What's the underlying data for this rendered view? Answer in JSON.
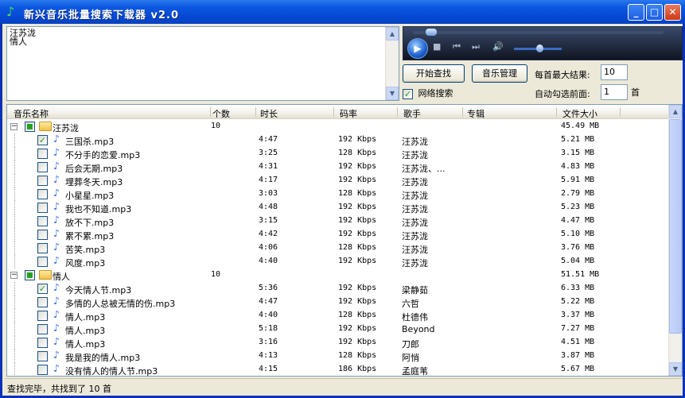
{
  "window": {
    "title": "新兴音乐批量搜索下载器 v2.0",
    "minimize": "_",
    "maximize": "□",
    "close": "✕"
  },
  "keywords": [
    "汪苏泷",
    "情人"
  ],
  "player": {
    "play": "▶",
    "stop": "■",
    "prev": "⏮",
    "next": "⏭",
    "volume": "🔊"
  },
  "controls": {
    "search_button": "开始查找",
    "manage_button": "音乐管理",
    "network_search_label": "网络搜索",
    "network_search_checked": true,
    "max_results_label": "每首最大结果:",
    "max_results_value": "10",
    "auto_select_label": "自动勾选前面:",
    "auto_select_value": "1",
    "auto_select_unit": "首"
  },
  "columns": [
    "音乐名称",
    "个数",
    "时长",
    "码率",
    "歌手",
    "专辑",
    "文件大小"
  ],
  "groups": [
    {
      "name": "汪苏泷",
      "count": "10",
      "size": "45.49 MB",
      "items": [
        {
          "name": "三国杀.mp3",
          "duration": "4:47",
          "bitrate": "192 Kbps",
          "singer": "汪苏泷",
          "size": "5.21 MB",
          "checked": true
        },
        {
          "name": "不分手的恋爱.mp3",
          "duration": "3:25",
          "bitrate": "128 Kbps",
          "singer": "汪苏泷",
          "size": "3.15 MB",
          "checked": false
        },
        {
          "name": "后会无期.mp3",
          "duration": "4:31",
          "bitrate": "192 Kbps",
          "singer": "汪苏泷、...",
          "size": "4.83 MB",
          "checked": false
        },
        {
          "name": "埋葬冬天.mp3",
          "duration": "4:17",
          "bitrate": "192 Kbps",
          "singer": "汪苏泷",
          "size": "5.91 MB",
          "checked": false
        },
        {
          "name": "小星星.mp3",
          "duration": "3:03",
          "bitrate": "128 Kbps",
          "singer": "汪苏泷",
          "size": "2.79 MB",
          "checked": false
        },
        {
          "name": "我也不知道.mp3",
          "duration": "4:48",
          "bitrate": "192 Kbps",
          "singer": "汪苏泷",
          "size": "5.23 MB",
          "checked": false
        },
        {
          "name": "放不下.mp3",
          "duration": "3:15",
          "bitrate": "192 Kbps",
          "singer": "汪苏泷",
          "size": "4.47 MB",
          "checked": false
        },
        {
          "name": "累不累.mp3",
          "duration": "4:42",
          "bitrate": "192 Kbps",
          "singer": "汪苏泷",
          "size": "5.10 MB",
          "checked": false
        },
        {
          "name": "苦笑.mp3",
          "duration": "4:06",
          "bitrate": "128 Kbps",
          "singer": "汪苏泷",
          "size": "3.76 MB",
          "checked": false
        },
        {
          "name": "风度.mp3",
          "duration": "4:40",
          "bitrate": "192 Kbps",
          "singer": "汪苏泷",
          "size": "5.04 MB",
          "checked": false
        }
      ]
    },
    {
      "name": "情人",
      "count": "10",
      "size": "51.51 MB",
      "items": [
        {
          "name": "今天情人节.mp3",
          "duration": "5:36",
          "bitrate": "192 Kbps",
          "singer": "梁静茹",
          "size": "6.33 MB",
          "checked": true
        },
        {
          "name": "多情的人总被无情的伤.mp3",
          "duration": "4:47",
          "bitrate": "192 Kbps",
          "singer": "六哲",
          "size": "5.22 MB",
          "checked": false
        },
        {
          "name": "情人.mp3",
          "duration": "4:40",
          "bitrate": "128 Kbps",
          "singer": "杜德伟",
          "size": "3.37 MB",
          "checked": false
        },
        {
          "name": "情人.mp3",
          "duration": "5:18",
          "bitrate": "192 Kbps",
          "singer": "Beyond",
          "size": "7.27 MB",
          "checked": false
        },
        {
          "name": "情人.mp3",
          "duration": "3:16",
          "bitrate": "192 Kbps",
          "singer": "刀郎",
          "size": "4.51 MB",
          "checked": false
        },
        {
          "name": "我是我的情人.mp3",
          "duration": "4:13",
          "bitrate": "128 Kbps",
          "singer": "阿悄",
          "size": "3.87 MB",
          "checked": false
        },
        {
          "name": "没有情人的情人节.mp3",
          "duration": "4:15",
          "bitrate": "186 Kbps",
          "singer": "孟庭苇",
          "size": "5.67 MB",
          "checked": false
        }
      ]
    }
  ],
  "status": "查找完毕，共找到了 10 首"
}
